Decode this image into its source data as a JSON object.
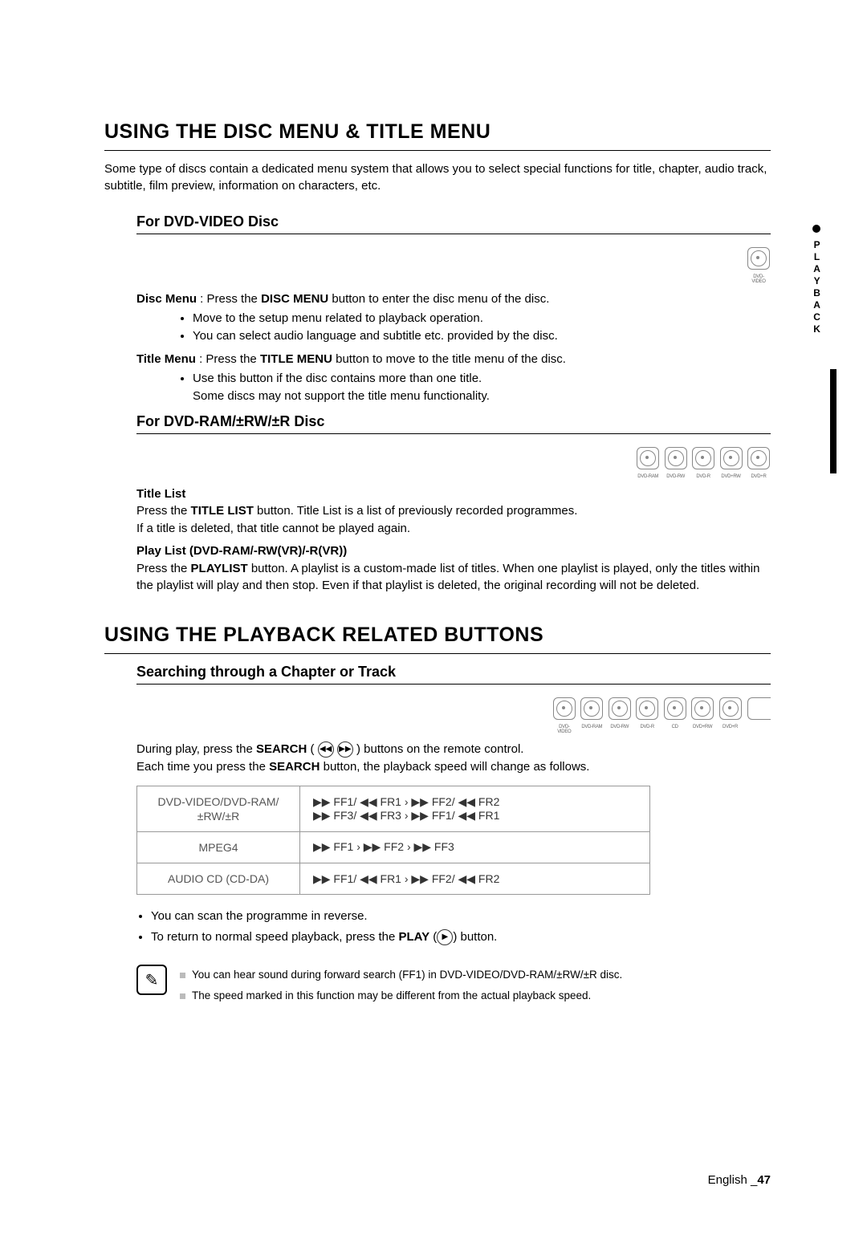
{
  "side_tab": {
    "label": "PLAYBACK"
  },
  "section1": {
    "title": "USING THE DISC MENU & TITLE MENU",
    "intro": "Some type of discs contain a dedicated menu system that allows you to select special functions for title, chapter, audio track, subtitle, film preview, information on characters, etc."
  },
  "sub1a": {
    "heading": "For DVD-VIDEO Disc",
    "disc_icons": [
      "DVD-VIDEO"
    ],
    "disc_menu_label": "Disc Menu",
    "disc_menu_text": " : Press the ",
    "disc_menu_btn": "DISC MENU",
    "disc_menu_text2": " button to enter the disc menu of the disc.",
    "disc_menu_b1": "Move to the setup menu related to playback operation.",
    "disc_menu_b2": "You can select audio language and subtitle etc. provided by the disc.",
    "title_menu_label": "Title Menu",
    "title_menu_text": " : Press the ",
    "title_menu_btn": "TITLE MENU",
    "title_menu_text2": " button to move to the title menu of the disc.",
    "title_menu_b1": "Use this button if the disc contains more than one title.",
    "title_menu_b2": "Some discs may not support the title menu functionality."
  },
  "sub1b": {
    "heading": "For DVD-RAM/±RW/±R Disc",
    "disc_icons": [
      "DVD-RAM",
      "DVD-RW",
      "DVD-R",
      "DVD+RW",
      "DVD+R"
    ],
    "title_list_label": "Title List",
    "title_list_line1a": "Press the ",
    "title_list_btn": "TITLE LIST",
    "title_list_line1b": " button. Title List is a list of previously recorded programmes.",
    "title_list_line2": "If a title is deleted, that title cannot be played again.",
    "play_list_label": "Play List (DVD-RAM/-RW(VR)/-R(VR))",
    "play_list_line_a": "Press the ",
    "play_list_btn": "PLAYLIST",
    "play_list_line_b": " button. A playlist is a custom-made list of titles. When one playlist is played, only the titles within the playlist will play and then stop. Even if that playlist is deleted, the original recording will not be deleted."
  },
  "section2": {
    "title": "USING THE PLAYBACK RELATED BUTTONS"
  },
  "sub2a": {
    "heading": "Searching through a Chapter or Track",
    "disc_icons": [
      "DVD-VIDEO",
      "DVD-RAM",
      "DVD-RW",
      "DVD-R",
      "CD",
      "DVD+RW",
      "DVD+R"
    ],
    "intro_a": "During play, press the ",
    "intro_btn": "SEARCH",
    "intro_b": " ( ",
    "intro_c": " ) buttons on the remote control.",
    "intro_line2a": "Each time you press the ",
    "intro_line2btn": "SEARCH",
    "intro_line2b": " button, the playback speed will change as follows.",
    "table": [
      {
        "label": "DVD-VIDEO/DVD-RAM/±RW/±R",
        "seq": "▶▶ FF1/ ◀◀ FR1  ›  ▶▶ FF2/ ◀◀ FR2\n▶▶ FF3/ ◀◀ FR3  ›  ▶▶ FF1/ ◀◀ FR1"
      },
      {
        "label": "MPEG4",
        "seq": "▶▶ FF1  ›  ▶▶ FF2  ›  ▶▶ FF3"
      },
      {
        "label": "AUDIO CD (CD-DA)",
        "seq": "▶▶ FF1/ ◀◀ FR1  ›  ▶▶ FF2/ ◀◀ FR2"
      }
    ],
    "note1": "You can scan the programme in reverse.",
    "note2a": "To return to normal speed playback, press the ",
    "note2btn": "PLAY",
    "note2b": " (",
    "note2c": ") button.",
    "boxed_notes": [
      "You can hear sound during forward search (FF1) in DVD-VIDEO/DVD-RAM/±RW/±R disc.",
      "The speed marked in this function may be different from the actual playback speed."
    ]
  },
  "footer": {
    "lang": "English",
    "sep": " _",
    "page": "47"
  }
}
